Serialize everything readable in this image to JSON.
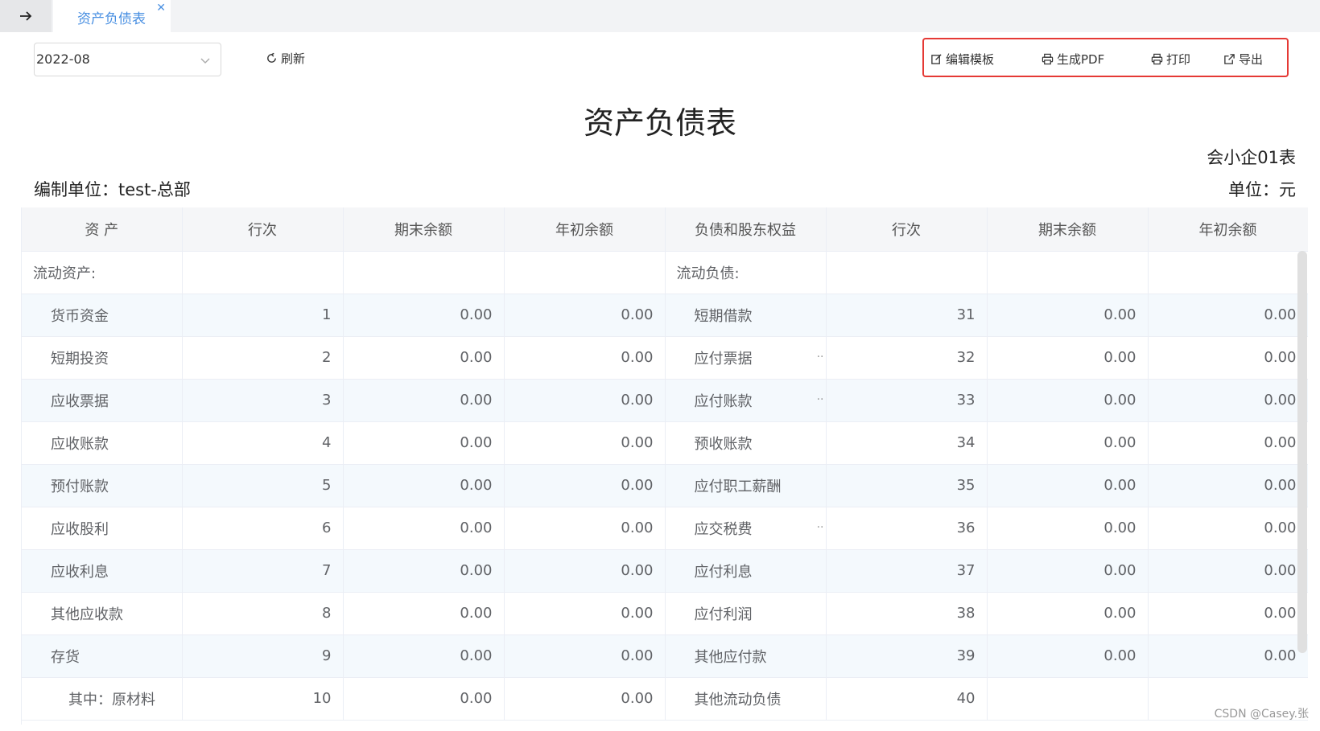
{
  "tabbar": {
    "tab_label": "资产负债表",
    "close_glyph": "✕",
    "back_icon": "arrow-right-icon"
  },
  "toolbar": {
    "date_value": "2022-08",
    "refresh_label": "刷新",
    "actions": {
      "edit_template": "编辑模板",
      "gen_pdf": "生成PDF",
      "print": "打印",
      "export": "导出"
    }
  },
  "report": {
    "title": "资产负债表",
    "form_code": "会小企01表",
    "org": "编制单位：test-总部",
    "unit": "单位：元"
  },
  "table": {
    "headers": [
      "资 产",
      "行次",
      "期末余额",
      "年初余额",
      "负债和股东权益",
      "行次",
      "期末余额",
      "年初余额"
    ],
    "rows": [
      [
        "流动资产:",
        "",
        "",
        "",
        "流动负债:",
        "",
        "",
        ""
      ],
      [
        "货币资金",
        "1",
        "0.00",
        "0.00",
        "短期借款",
        "31",
        "0.00",
        "0.00"
      ],
      [
        "短期投资",
        "2",
        "0.00",
        "0.00",
        "应付票据",
        "32",
        "0.00",
        "0.00"
      ],
      [
        "应收票据",
        "3",
        "0.00",
        "0.00",
        "应付账款",
        "33",
        "0.00",
        "0.00"
      ],
      [
        "应收账款",
        "4",
        "0.00",
        "0.00",
        "预收账款",
        "34",
        "0.00",
        "0.00"
      ],
      [
        "预付账款",
        "5",
        "0.00",
        "0.00",
        "应付职工薪酬",
        "35",
        "0.00",
        "0.00"
      ],
      [
        "应收股利",
        "6",
        "0.00",
        "0.00",
        "应交税费",
        "36",
        "0.00",
        "0.00"
      ],
      [
        "应收利息",
        "7",
        "0.00",
        "0.00",
        "应付利息",
        "37",
        "0.00",
        "0.00"
      ],
      [
        "其他应收款",
        "8",
        "0.00",
        "0.00",
        "应付利润",
        "38",
        "0.00",
        "0.00"
      ],
      [
        "存货",
        "9",
        "0.00",
        "0.00",
        "其他应付款",
        "39",
        "0.00",
        "0.00"
      ],
      [
        "其中：原材料",
        "10",
        "0.00",
        "0.00",
        "其他流动负债",
        "40",
        "",
        ""
      ]
    ],
    "trunc_marker": ".."
  },
  "watermark": "CSDN @Casey.张"
}
